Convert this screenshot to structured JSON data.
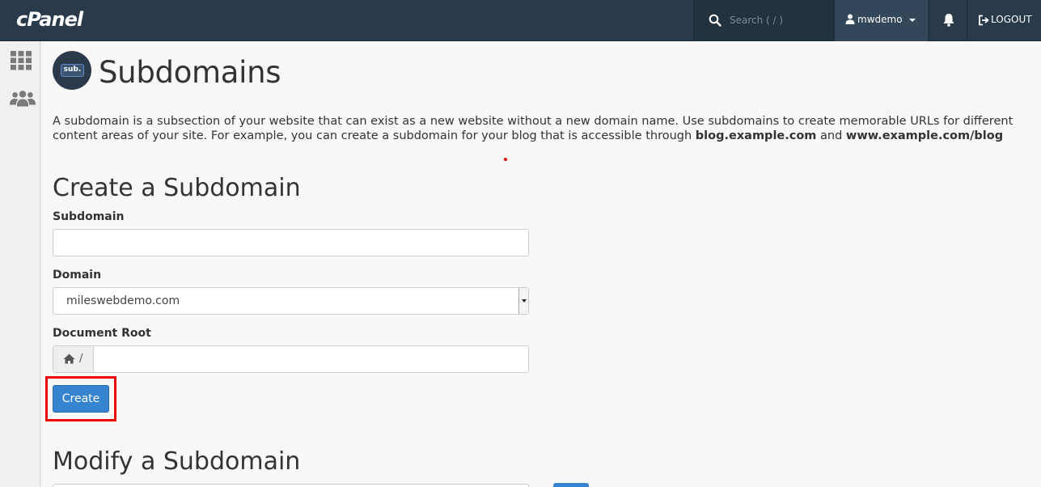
{
  "header": {
    "logo_text": "cPanel",
    "search_placeholder": "Search ( / )",
    "username": "mwdemo",
    "logout_label": "LOGOUT"
  },
  "page": {
    "icon_text": "sub.",
    "title": "Subdomains",
    "description_part1": "A subdomain is a subsection of your website that can exist as a new website without a new domain name. Use subdomains to create memorable URLs for different content areas of your site. For example, you can create a subdomain for your blog that is accessible through ",
    "description_bold1": "blog.example.com",
    "description_and": " and ",
    "description_bold2": "www.example.com/blog"
  },
  "create_form": {
    "section_title": "Create a Subdomain",
    "subdomain_label": "Subdomain",
    "subdomain_value": "",
    "domain_label": "Domain",
    "domain_selected": "mileswebdemo.com",
    "docroot_label": "Document Root",
    "docroot_prefix": "/",
    "docroot_value": "",
    "create_button": "Create"
  },
  "modify_section": {
    "title": "Modify a Subdomain"
  },
  "colors": {
    "topbar": "#293a4a",
    "primary_button": "#3683d0",
    "highlight": "#ee0000"
  }
}
